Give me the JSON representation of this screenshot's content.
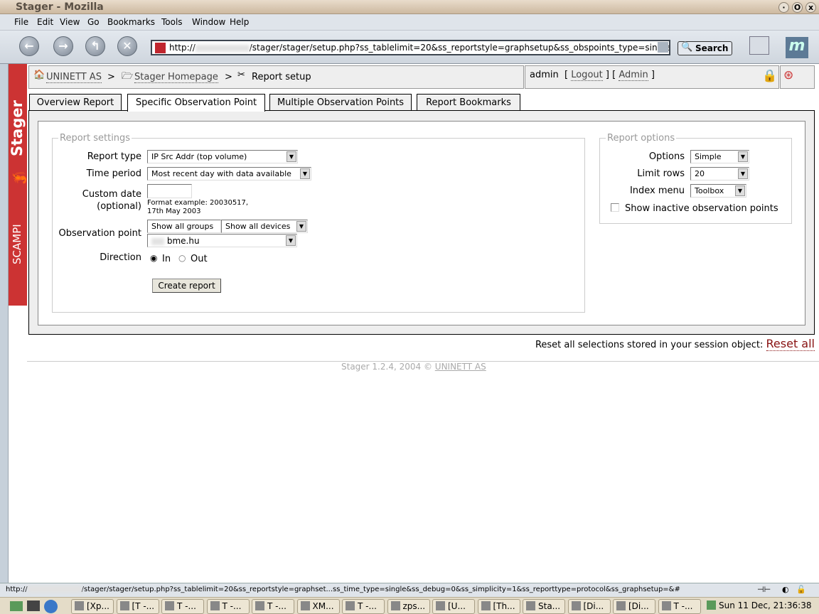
{
  "window": {
    "title": "Stager - Mozilla"
  },
  "menu": [
    "File",
    "Edit",
    "View",
    "Go",
    "Bookmarks",
    "Tools",
    "Window",
    "Help"
  ],
  "toolbar": {
    "url_prefix": "http://",
    "url_path": "/stager/stager/setup.php?ss_tablelimit=20&ss_reportstyle=graphsetup&ss_obspoints_type=single",
    "search_label": "Search"
  },
  "sidebar": {
    "brand": "Stager",
    "sub": "SCAMPI",
    "accent": "#cc3333"
  },
  "breadcrumb": {
    "home": "UNINETT AS",
    "sep": ">",
    "stager": "Stager Homepage",
    "current": "Report setup"
  },
  "user": {
    "name": "admin",
    "open": "[",
    "close": "]",
    "logout": "Logout",
    "admin": "Admin"
  },
  "tabs": [
    "Overview Report",
    "Specific Observation Point",
    "Multiple Observation Points",
    "Report Bookmarks"
  ],
  "settings": {
    "legend": "Report settings",
    "report_type_label": "Report type",
    "report_type": "IP Src Addr (top volume)",
    "time_period_label": "Time period",
    "time_period": "Most recent day with data available",
    "custom_date_label": "Custom date",
    "custom_date_label2": "(optional)",
    "custom_date_value": "",
    "format_hint": "Format example: 20030517,",
    "format_hint2": "17th May 2003",
    "obs_label": "Observation point",
    "groups": "Show all groups",
    "devices": "Show all devices",
    "device": "bme.hu",
    "direction_label": "Direction",
    "dir_in": "In",
    "dir_out": "Out",
    "direction_selected": "In",
    "create": "Create report"
  },
  "options": {
    "legend": "Report options",
    "options_label": "Options",
    "options_value": "Simple",
    "limit_label": "Limit rows",
    "limit_value": "20",
    "index_label": "Index menu",
    "index_value": "Toolbox",
    "inactive_label": "Show inactive observation points",
    "inactive_checked": false
  },
  "reset": {
    "text": "Reset all selections stored in your session object:",
    "link": "Reset all"
  },
  "footer": {
    "text": "Stager 1.2.4, 2004 ©",
    "link": "UNINETT AS"
  },
  "status": {
    "prefix": "http://",
    "path": "/stager/stager/setup.php?ss_tablelimit=20&ss_reportstyle=graphset...ss_time_type=single&ss_debug=0&ss_simplicity=1&ss_reporttype=protocol&ss_graphsetup=&#"
  },
  "taskbar": {
    "tasks": [
      "[Xp...",
      "[T -...",
      "T -...",
      "T -...",
      "T -...",
      "XM...",
      "T -...",
      "zps...",
      "[U...",
      "[Th...",
      "Sta...",
      "[Di...",
      "[Di...",
      "T -..."
    ],
    "clock": "Sun 11 Dec, 21:36:38"
  }
}
